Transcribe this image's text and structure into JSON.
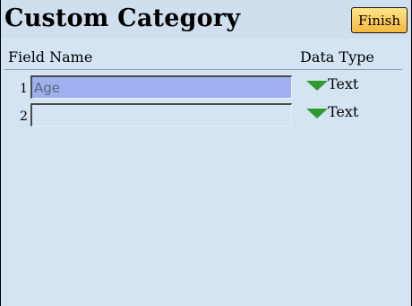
{
  "header": {
    "title": "Custom Category",
    "finish_label": "Finish"
  },
  "columns": {
    "field_name": "Field Name",
    "data_type": "Data Type"
  },
  "rows": [
    {
      "number": "1",
      "value": "Age",
      "type": "Text"
    },
    {
      "number": "2",
      "value": "",
      "type": "Text"
    }
  ],
  "icons": {
    "dropdown": "triangle-down-icon"
  },
  "colors": {
    "background": "#d4e4f3",
    "active_field": "#9eb0ef",
    "finish_button": "#f7c24f",
    "dropdown_arrow": "#2e9b2f"
  }
}
